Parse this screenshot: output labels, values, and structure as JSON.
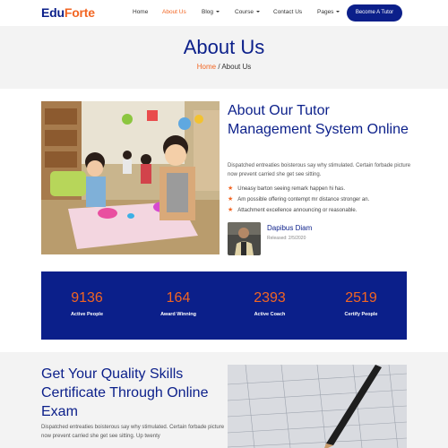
{
  "brand": {
    "name_part1": "Edu",
    "name_part2": "Forte"
  },
  "nav": {
    "items": [
      {
        "label": "Home"
      },
      {
        "label": "About Us"
      },
      {
        "label": "Blog"
      },
      {
        "label": "Course"
      },
      {
        "label": "Contact Us"
      },
      {
        "label": "Pages"
      }
    ],
    "cta": "Become A Tutor"
  },
  "hero": {
    "title": "About Us",
    "breadcrumb_home": "Home",
    "breadcrumb_sep": " / ",
    "breadcrumb_current": "About Us"
  },
  "about": {
    "title": "About Our Tutor Management System Online",
    "description": "Dispatched entreaties boisterous say why stimulated. Certain forbade picture now prevent carried she get see sitting.",
    "bullets": [
      "Uneasy barton seeing remark happen hi has.",
      "Am possible offering contempt mr distance stronger an.",
      "Attachment excellence announcing or reasonable."
    ],
    "author_name": "Dapibus Diam",
    "author_date": "Released: 2/5/2020"
  },
  "stats": [
    {
      "value": "9136",
      "label": "Active People"
    },
    {
      "value": "164",
      "label": "Award Winning"
    },
    {
      "value": "2393",
      "label": "Active Coach"
    },
    {
      "value": "2519",
      "label": "Certify People"
    }
  ],
  "certificate": {
    "title": "Get Your Quality Skills Certificate Through Online Exam",
    "description": "Dispatched entreaties boisterous say why stimulated. Certain forbade picture now prevent carried she get see sitting. Up twenty"
  },
  "colors": {
    "primary": "#0b1f8a",
    "accent": "#f26522",
    "light_bg": "#f3f3f3"
  }
}
